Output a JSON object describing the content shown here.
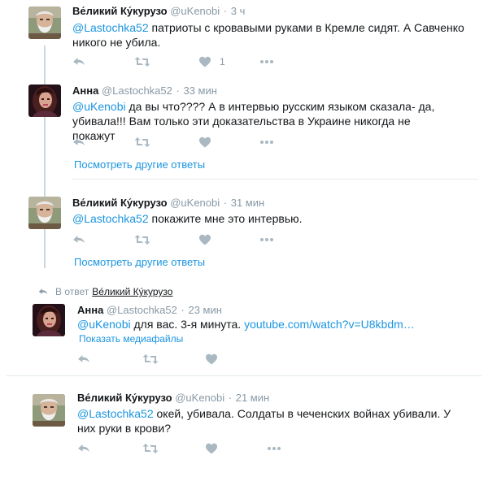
{
  "thread": {
    "in_reply_label": "В ответ",
    "in_reply_target": "Ве́ликий Ку́курузо",
    "show_more_label": "Посмотреть другие ответы",
    "show_media_label": "Показать медиафайлы"
  },
  "tweets": [
    {
      "fullname": "Ве́ликий Ку́курузо",
      "handle": "@uKenobi",
      "time": "3 ч",
      "mention": "@Lastochka52",
      "text": " патриоты с кровавыми руками в Кремле сидят. А Савченко никого не убила.",
      "like_count": "1"
    },
    {
      "fullname": "Анна",
      "handle": "@Lastochka52",
      "time": "33 мин",
      "mention": "@uKenobi",
      "text": " да вы что???? А в интервью русским языком сказала- да, убивала!!! Вам только эти доказательства в Украине никогда не покажут"
    },
    {
      "fullname": "Ве́ликий Ку́курузо",
      "handle": "@uKenobi",
      "time": "31 мин",
      "mention": "@Lastochka52",
      "text": " покажите мне это интервью."
    },
    {
      "fullname": "Анна",
      "handle": "@Lastochka52",
      "time": "23 мин",
      "mention": "@uKenobi",
      "text": " для вас. 3-я минута. ",
      "link": "youtube.com/watch?v=U8kbdm…"
    },
    {
      "fullname": "Ве́ликий Ку́курузо",
      "handle": "@uKenobi",
      "time": "21 мин",
      "mention": "@Lastochka52",
      "text": " окей, убивала. Солдаты в чеченских войнах убивали. У них руки в крови?"
    }
  ],
  "dot": "·",
  "icons": {
    "reply": "reply-icon",
    "retweet": "retweet-icon",
    "like": "heart-icon",
    "more": "more-dots-icon",
    "in_reply_arrow": "reply-arrow-icon"
  },
  "colors": {
    "link": "#1b95e0",
    "secondary_text": "#8899a6",
    "action_icon": "#aab8c2",
    "thread_line": "#ccd6dd"
  }
}
